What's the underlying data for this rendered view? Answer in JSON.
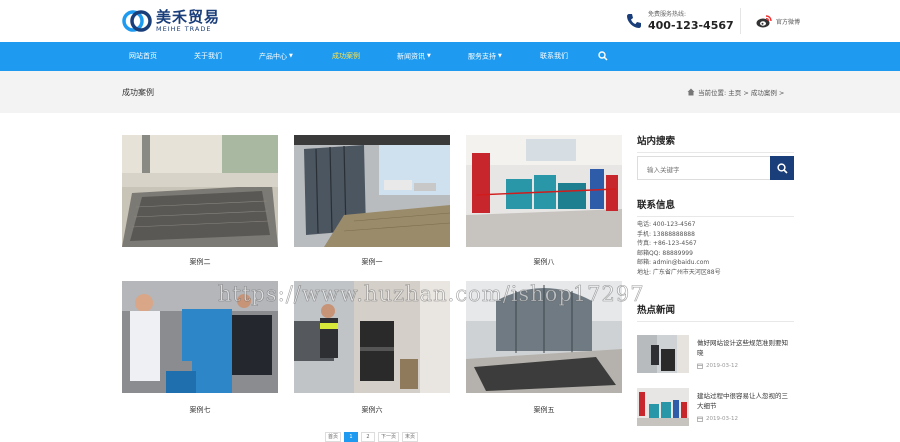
{
  "brand": {
    "name_cn": "美禾贸易",
    "name_en": "MEIHE TRADE",
    "colors": {
      "primary": "#1e9bf0",
      "dark": "#1a3e7a",
      "active_nav": "#ffe24a"
    }
  },
  "header": {
    "hotline_label": "免费服务热线:",
    "hotline_number": "400-123-4567",
    "weibo_label": "官方微博"
  },
  "nav": {
    "items": [
      {
        "label": "网站首页",
        "dropdown": false
      },
      {
        "label": "关于我们",
        "dropdown": false
      },
      {
        "label": "产品中心",
        "dropdown": true
      },
      {
        "label": "成功案例",
        "dropdown": false,
        "active": true
      },
      {
        "label": "新闻资讯",
        "dropdown": true
      },
      {
        "label": "服务支持",
        "dropdown": true
      },
      {
        "label": "联系我们",
        "dropdown": false
      }
    ]
  },
  "breadcrumb": {
    "page_title": "成功案例",
    "path": "当前位置: 主页 > 成功案例 >"
  },
  "cases": [
    {
      "label": "案例二"
    },
    {
      "label": "案例一"
    },
    {
      "label": "案例八"
    },
    {
      "label": "案例七"
    },
    {
      "label": "案例六"
    },
    {
      "label": "案例五"
    }
  ],
  "pagination": [
    "首页",
    "1",
    "2",
    "下一页",
    "末页"
  ],
  "sidebar": {
    "search_title": "站内搜索",
    "search_placeholder": "输入关键字",
    "contact_title": "联系信息",
    "contact_lines": [
      "电话: 400-123-4567",
      "手机: 13888888888",
      "传真: +86-123-4567",
      "邮箱QQ: 88889999",
      "邮箱: admin@baidu.com",
      "地址: 广东省广州市天河区88号"
    ],
    "news_title": "热点新闻",
    "news": [
      {
        "title": "做好网站设计这些规范准则要知晓",
        "date": "2019-03-12"
      },
      {
        "title": "建站过程中很容易让人忽视的三大细节",
        "date": "2019-03-12"
      }
    ]
  },
  "watermark": "https://www.huzhan.com/ishop17297"
}
